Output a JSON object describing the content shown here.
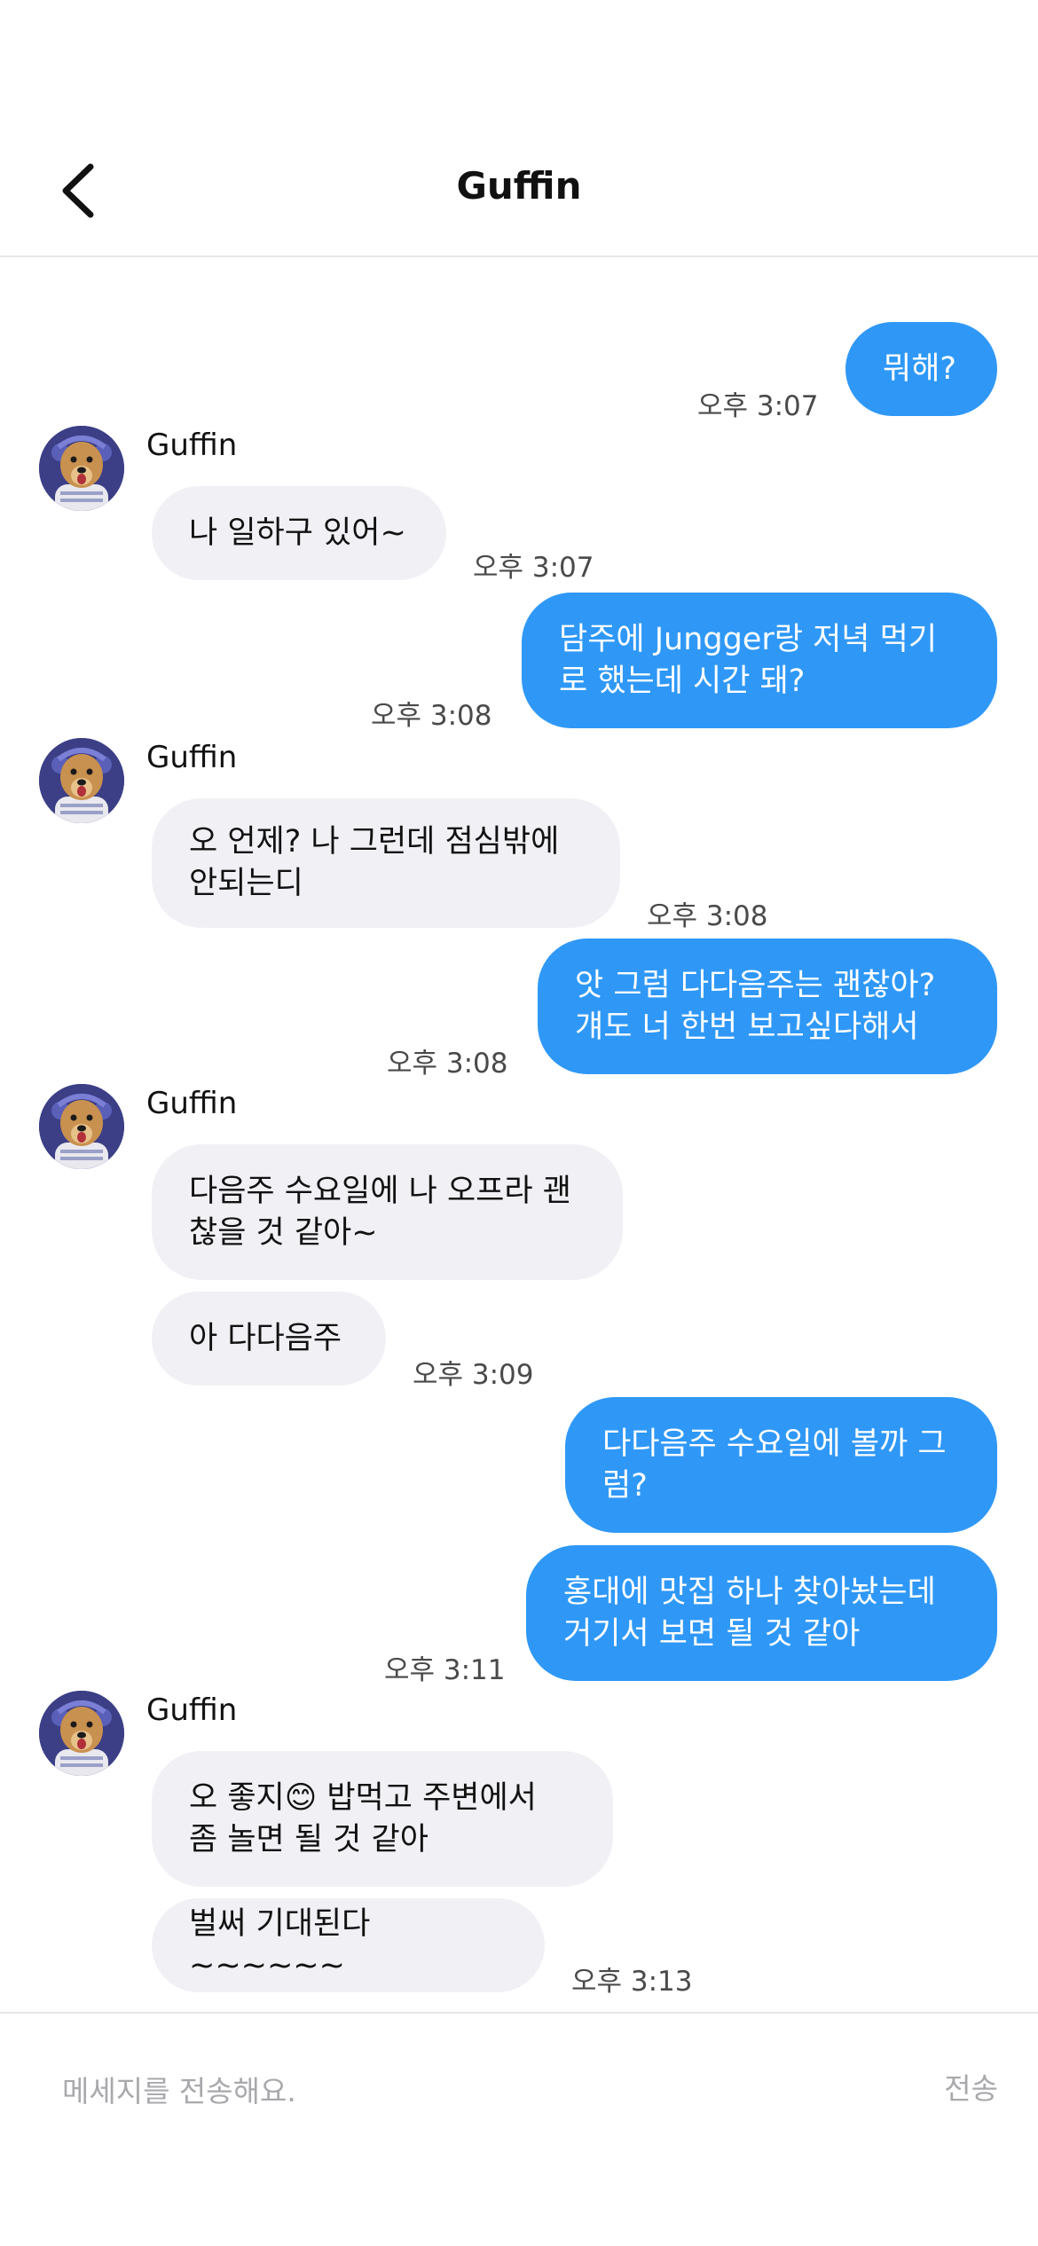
{
  "header": {
    "title": "Guffin",
    "back_icon": "chevron-left-icon"
  },
  "messages": [
    {
      "from": "me",
      "text": "뭐해?",
      "time": "오후 3:07"
    },
    {
      "from": "them",
      "sender": "Guffin",
      "text": "나 일하구 있어~",
      "time": "오후 3:07"
    },
    {
      "from": "me",
      "text": "담주에 Jungger랑 저녁 먹기\n로 했는데 시간 돼?",
      "time": "오후 3:08"
    },
    {
      "from": "them",
      "sender": "Guffin",
      "text": "오 언제? 나 그런데 점심밖에\n안되는디",
      "time": "오후 3:08"
    },
    {
      "from": "me",
      "text": "앗 그럼 다다음주는 괜찮아?\n걔도 너 한번 보고싶다해서",
      "time": "오후 3:08"
    },
    {
      "from": "them",
      "sender": "Guffin",
      "text": "다음주 수요일에 나 오프라 괜\n찮을 것 같아~"
    },
    {
      "from": "them",
      "text": "아 다다음주",
      "time": "오후 3:09"
    },
    {
      "from": "me",
      "text": "다다음주 수요일에 볼까 그\n럼?"
    },
    {
      "from": "me",
      "text": "홍대에 맛집 하나 찾아놨는데\n거기서 보면 될 것 같아",
      "time": "오후 3:11"
    },
    {
      "from": "them",
      "sender": "Guffin",
      "text": "오 좋지😊 밥먹고 주변에서\n좀 놀면 될 것 같아"
    },
    {
      "from": "them",
      "text": "벌써 기대된다~~~~~~",
      "time": "오후 3:13"
    }
  ],
  "composer": {
    "placeholder": "메세지를 전송해요.",
    "send_label": "전송"
  },
  "colors": {
    "my_bubble": "#2f98f7",
    "their_bubble": "#f1f1f5",
    "avatar_bg": "#3c3f86"
  }
}
